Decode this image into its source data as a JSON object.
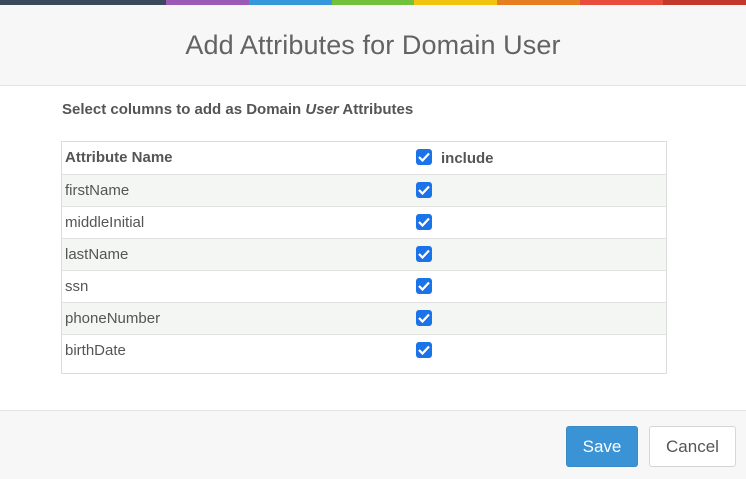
{
  "header": {
    "title": "Add Attributes for Domain User",
    "color_strip": [
      "#3b4a5a",
      "#3b4a5a",
      "#9b59b6",
      "#3498db",
      "#72c13d",
      "#f1c40f",
      "#e67e22",
      "#e74c3c",
      "#c0392b"
    ]
  },
  "body": {
    "subtitle_prefix": "Select columns to add as Domain ",
    "subtitle_emphasis": "User",
    "subtitle_suffix": " Attributes"
  },
  "table": {
    "columns": {
      "name": "Attribute Name",
      "include": "include"
    },
    "header_checked": true,
    "rows": [
      {
        "name": "firstName",
        "checked": true
      },
      {
        "name": "middleInitial",
        "checked": true
      },
      {
        "name": "lastName",
        "checked": true
      },
      {
        "name": "ssn",
        "checked": true
      },
      {
        "name": "phoneNumber",
        "checked": true
      },
      {
        "name": "birthDate",
        "checked": true
      }
    ]
  },
  "footer": {
    "save_label": "Save",
    "cancel_label": "Cancel"
  },
  "colors": {
    "accent": "#3a93d4",
    "checkbox": "#1a73e8"
  }
}
